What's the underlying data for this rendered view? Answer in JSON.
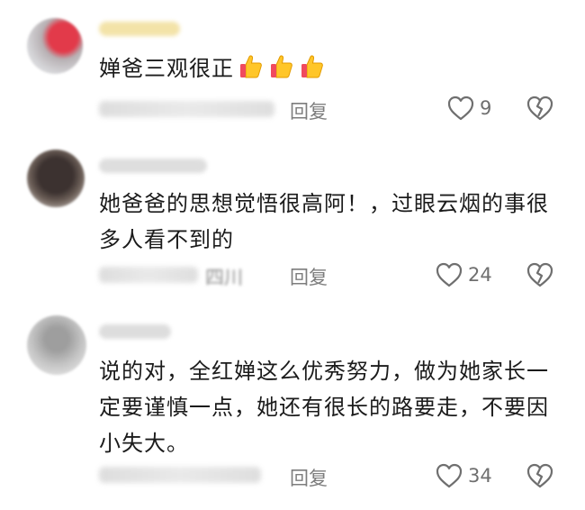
{
  "comments": [
    {
      "text": "婵爸三观很正",
      "emoji": "thumbs-up-icon",
      "emoji_count": 3,
      "reply_label": "回复",
      "like_count": "9"
    },
    {
      "text": "她爸爸的思想觉悟很高阿！，过眼云烟的事很多人看不到的",
      "location": "四川",
      "reply_label": "回复",
      "like_count": "24"
    },
    {
      "text": "说的对，全红婵这么优秀努力，做为她家长一定要谨慎一点，她还有很长的路要走，不要因小失大。",
      "reply_label": "回复",
      "like_count": "34"
    }
  ],
  "colors": {
    "text": "#1b1b1b",
    "meta": "#7d7d7d",
    "icon": "#6f6f6f"
  }
}
